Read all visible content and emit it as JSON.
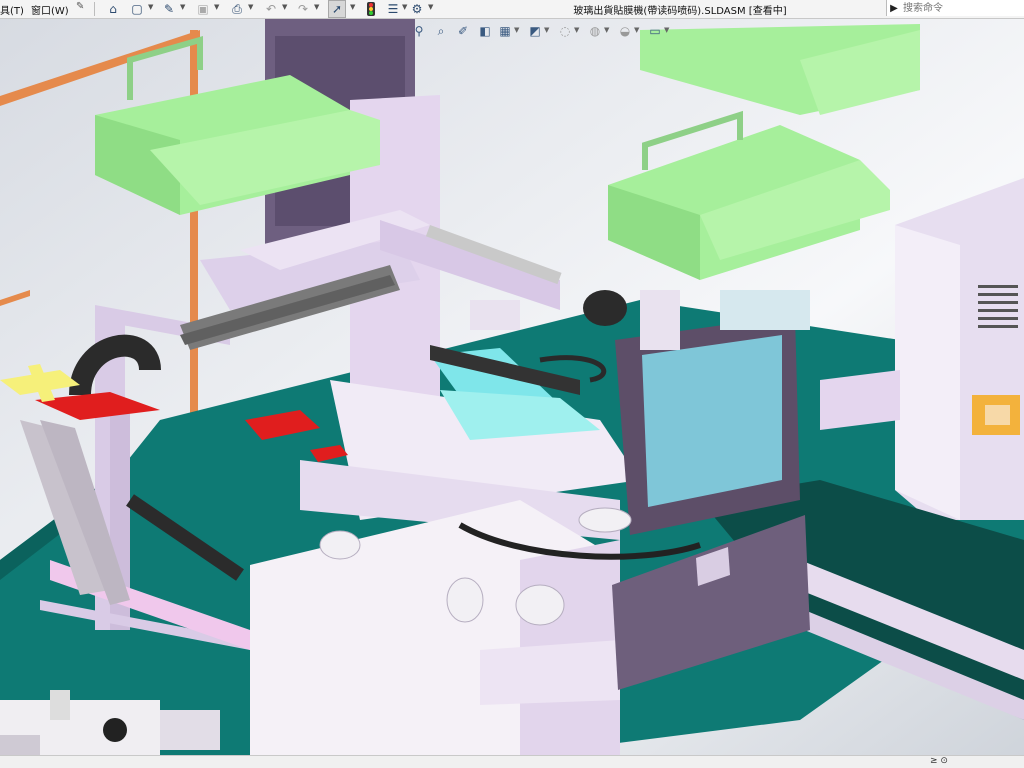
{
  "menu": {
    "tools": "具(T)",
    "window": "窗口(W)"
  },
  "document_title": "玻璃出貨貼膜機(帶读码喷码).SLDASM [查看中]",
  "search": {
    "placeholder": "搜索命令"
  },
  "toolbar_icons": [
    "home-icon",
    "new-document-icon",
    "open-folder-icon",
    "save-icon",
    "print-icon",
    "undo-icon",
    "redo-icon",
    "select-cursor-icon",
    "rebuild-traffic-light-icon",
    "file-properties-icon",
    "options-gear-icon"
  ],
  "viewport_icons": [
    "zoom-to-fit-icon",
    "zoom-area-icon",
    "previous-view-icon",
    "section-view-icon",
    "view-orientation-icon",
    "display-style-icon",
    "hide-show-items-icon",
    "edit-appearance-icon",
    "apply-scene-icon",
    "view-settings-icon"
  ],
  "colors": {
    "platform_teal": "#0e7a74",
    "guard_green": "#a6ef9b",
    "frame_lilac": "#e4d6ee",
    "monitor_screen": "#7fc6d8",
    "accent_red": "#e01e1e",
    "cable_chain": "#2b2b2b"
  },
  "statusbar": {
    "left_text": "",
    "right_text": "≥ ⊙"
  }
}
